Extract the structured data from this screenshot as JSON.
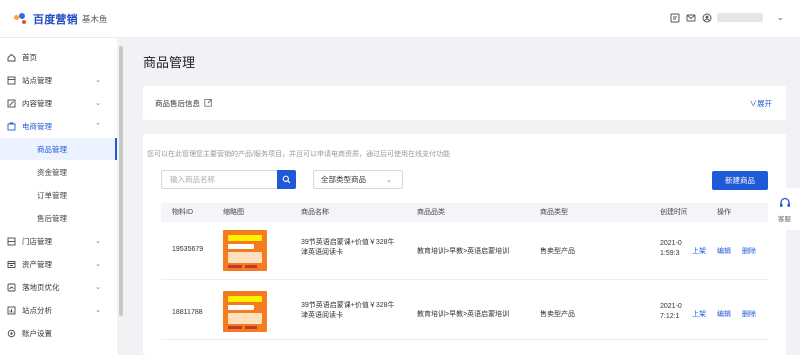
{
  "header": {
    "brand": "百度营销",
    "product": "基木鱼",
    "icons": [
      "notice-icon",
      "mail-icon",
      "user-icon",
      "chevron-down-icon"
    ]
  },
  "sidebar": {
    "items": [
      {
        "label": "首页",
        "icon": "home-icon"
      },
      {
        "label": "站点管理",
        "icon": "site-icon",
        "arrow": "⌄"
      },
      {
        "label": "内容管理",
        "icon": "content-icon",
        "arrow": "⌄"
      },
      {
        "label": "电商管理",
        "icon": "shop-icon",
        "arrow": "⌃"
      },
      {
        "label": "商品管理"
      },
      {
        "label": "资金管理"
      },
      {
        "label": "订单管理"
      },
      {
        "label": "售后管理"
      },
      {
        "label": "门店管理",
        "icon": "store-icon",
        "arrow": "⌄"
      },
      {
        "label": "资产管理",
        "icon": "asset-icon",
        "arrow": "⌄"
      },
      {
        "label": "落地页优化",
        "icon": "optimize-icon",
        "arrow": "⌄"
      },
      {
        "label": "站点分析",
        "icon": "analysis-icon",
        "arrow": "⌄"
      },
      {
        "label": "账户设置",
        "icon": "settings-icon"
      }
    ]
  },
  "page": {
    "title": "商品管理",
    "info_label": "商品售后信息",
    "expand_label": "展开",
    "expand_icon": "∨",
    "tip": "您可以在此管理您主要营销的产品/服务项目，并且可以申请电商资质，通过后可使用在线支付功能",
    "search_placeholder": "输入商品名称",
    "type_select": "全部类型商品",
    "new_button": "新建商品"
  },
  "table": {
    "headers": [
      "物料ID",
      "缩略图",
      "商品名称",
      "商品品类",
      "商品类型",
      "创建时间",
      "操作"
    ],
    "rows": [
      {
        "id": "19535679",
        "name": "39节英语启蒙课+价值￥328牛津英语阅读卡",
        "category": "教育培训>早教>英语启蒙培训",
        "type": "售卖型产品",
        "date_line1": "2021-0",
        "date_line2": "1:59:3",
        "actions": [
          "上架",
          "编辑",
          "删除"
        ]
      },
      {
        "id": "18811788",
        "name": "39节英语启蒙课+价值￥328牛津英语阅读卡",
        "category": "教育培训>早教>英语启蒙培训",
        "type": "售卖型产品",
        "date_line1": "2021-0",
        "date_line2": "7:12:1",
        "actions": [
          "上架",
          "编辑",
          "删除"
        ]
      }
    ]
  },
  "float_service": {
    "label": "客服",
    "icon": "customer-service-icon"
  },
  "colors": {
    "primary": "#1e5ad7",
    "thumbnail": "#f47b20"
  }
}
